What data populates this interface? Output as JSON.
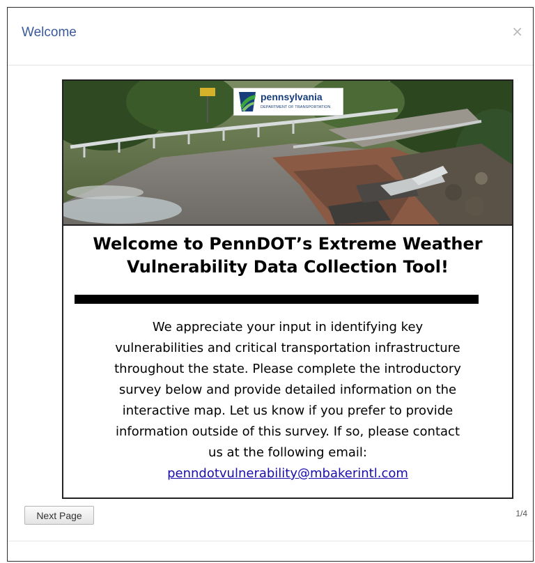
{
  "dialog": {
    "title": "Welcome",
    "close_glyph": "×",
    "close_icon": "close-icon"
  },
  "banner": {
    "logo_name": "pennsylvania",
    "logo_subtitle": "DEPARTMENT OF TRANSPORTATION",
    "logo_icon": "pennsylvania-keystone-logo-icon"
  },
  "content": {
    "heading_line1": "Welcome to PennDOT’s Extreme Weather",
    "heading_line2": "Vulnerability Data Collection Tool!",
    "body_lines": [
      "We appreciate your input in identifying key",
      "vulnerabilities and critical transportation infrastructure",
      "throughout the state.  Please complete the introductory",
      "survey below and provide detailed information on the",
      "interactive map.  Let us know if you prefer to  provide",
      "information outside of this survey.  If so, please contact",
      "us at the following email:"
    ],
    "email": "penndotvulnerability@mbakerintl.com"
  },
  "pagination": {
    "next_label": "Next Page",
    "page_indicator": "1/4"
  },
  "colors": {
    "title": "#3b5998",
    "link": "#1a0dab",
    "logo_blue": "#173d7a",
    "logo_green": "#3aa53c"
  }
}
